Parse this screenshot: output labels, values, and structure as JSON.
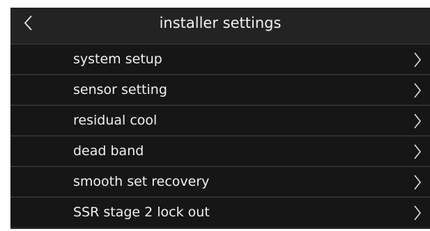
{
  "header": {
    "title": "installer settings",
    "back_icon": "chevron-left-icon"
  },
  "menu": {
    "items": [
      {
        "label": "system setup",
        "icon": "chevron-right-icon"
      },
      {
        "label": "sensor setting",
        "icon": "chevron-right-icon"
      },
      {
        "label": "residual cool",
        "icon": "chevron-right-icon"
      },
      {
        "label": "dead band",
        "icon": "chevron-right-icon"
      },
      {
        "label": "smooth set recovery",
        "icon": "chevron-right-icon"
      },
      {
        "label": "SSR stage 2 lock out",
        "icon": "chevron-right-icon"
      }
    ]
  },
  "colors": {
    "background": "#232323",
    "row": "#161616",
    "divider": "#3c3c3c",
    "text": "#f0f0f0"
  }
}
